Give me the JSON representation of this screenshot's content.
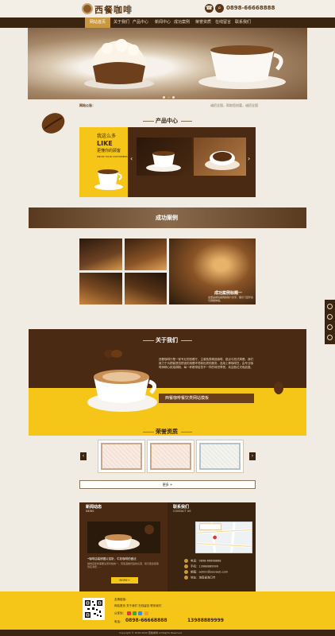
{
  "header": {
    "logo_text": "西餐咖啡",
    "hotline": "0898-66668888"
  },
  "nav": {
    "items": [
      "网站首页",
      "关于我们",
      "产品中心",
      "新闻中心",
      "成功案例",
      "荣誉资质",
      "在线留言",
      "联系我们"
    ],
    "active_index": 0
  },
  "notice": {
    "label": "网站公告：",
    "text": "诚招全国，帮助您创富，诚招全国"
  },
  "products": {
    "title": "产品中心",
    "promo_small": "我这么多",
    "promo_like": "LIKE",
    "promo_sub": "更懂你的顾客",
    "promo_en": "KNOW YOUR CUSTOMERS"
  },
  "cases": {
    "title": "成功案例",
    "caption": "成功案例标题一",
    "description": "这里是成功案例的简介文字，展示门店环境与用餐体验。"
  },
  "about": {
    "title": "关于我们",
    "text": "西餐咖啡厅是一家专业的西餐厅，主营各类精品咖啡、甜点与西式简餐。我们致力于为顾客提供舒适的用餐环境和优质的服务，选用上等咖啡豆，由专业咖啡师精心烘焙调制，每一杯都带给您不一样的味觉享受。欢迎各位光临品鉴。",
    "button": "西餐咖啡餐饮类网站模板"
  },
  "honors": {
    "title": "荣誉资质",
    "more": "更多 +"
  },
  "news": {
    "title": "新闻动态",
    "en": "NEWS",
    "headline": "•咖啡店装修图片赏析，牛奶咖啡的做法",
    "summary": "咖啡店装修需要注意风格统一，营造温馨舒适的氛围，吸引更多顾客到店消费……",
    "more": "MORE+"
  },
  "contact": {
    "title": "联系我们",
    "en": "CONTACT US",
    "phone": "电话：0898-66668888",
    "mobile": "手机：13988889999",
    "email": "邮箱：admin@youweb.com",
    "address": "地址：海南省海口市"
  },
  "footer": {
    "friend_label": "友情链接：",
    "links": "网站首页   关于我们   在线留言   联系我们",
    "share_label": "分享到：",
    "tel_label": "电话：",
    "phone1": "0898-66668888",
    "phone2": "13988889999",
    "copyright": "Copyright © 2018-2020 西餐咖啡 All Rights Reserved"
  },
  "colors": {
    "brand_dark": "#3b2410",
    "brand_gold": "#c9973f",
    "accent_yellow": "#f5c518"
  }
}
